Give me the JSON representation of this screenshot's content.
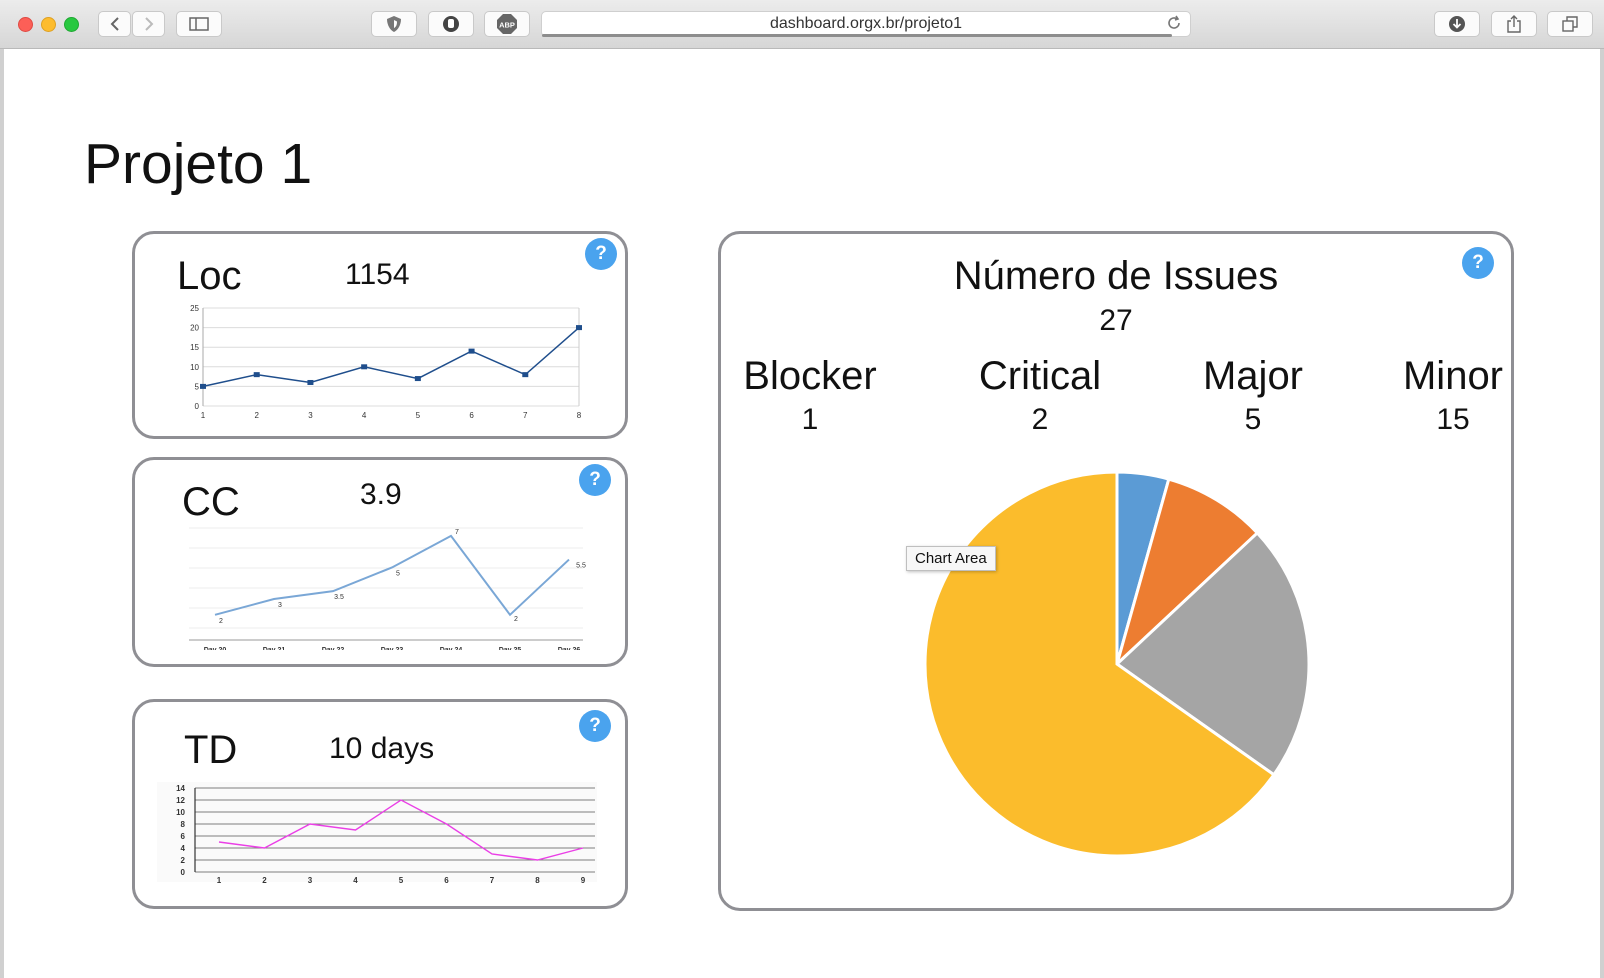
{
  "browser": {
    "url": "dashboard.orgx.br/projeto1",
    "icons": [
      "back-icon",
      "forward-icon",
      "sidebar-icon",
      "shield-icon",
      "hand-icon",
      "adblock-icon",
      "reload-icon",
      "download-icon",
      "share-icon",
      "tabs-icon"
    ],
    "adblock_label": "ABP"
  },
  "page": {
    "title": "Projeto 1"
  },
  "help_label": "?",
  "cards": {
    "loc": {
      "label": "Loc",
      "value": "1154",
      "chart_data": {
        "type": "line",
        "x": [
          1,
          2,
          3,
          4,
          5,
          6,
          7,
          8
        ],
        "values": [
          5,
          8,
          6,
          10,
          7,
          14,
          8,
          20
        ],
        "ylim": [
          0,
          25
        ],
        "yticks": [
          0,
          5,
          10,
          15,
          20,
          25
        ],
        "color": "#1f4e8c"
      }
    },
    "cc": {
      "label": "CC",
      "value": "3.9",
      "chart_data": {
        "type": "line",
        "categories": [
          "Day 20",
          "Day 21",
          "Day 22",
          "Day 23",
          "Day 24",
          "Day 25",
          "Day 26"
        ],
        "values": [
          2,
          3,
          3.5,
          5,
          7,
          2,
          5.5
        ],
        "data_labels": [
          "2",
          "3",
          "3.5",
          "5",
          "7",
          "2",
          "5.5"
        ],
        "ylim": [
          1,
          7.5
        ],
        "color": "#7aa7d6"
      }
    },
    "td": {
      "label": "TD",
      "value": "10 days",
      "chart_data": {
        "type": "line",
        "x": [
          1,
          2,
          3,
          4,
          5,
          6,
          7,
          8,
          9
        ],
        "values": [
          5,
          4,
          8,
          7,
          12,
          8,
          3,
          2,
          4
        ],
        "ylim": [
          0,
          14
        ],
        "yticks": [
          0,
          2,
          4,
          6,
          8,
          10,
          12,
          14
        ],
        "color": "#ea3fe6"
      }
    }
  },
  "issues": {
    "title": "Número de Issues",
    "total": "27",
    "tooltip": "Chart Area",
    "categories": [
      {
        "name": "Blocker",
        "value": "1"
      },
      {
        "name": "Critical",
        "value": "2"
      },
      {
        "name": "Major",
        "value": "5"
      },
      {
        "name": "Minor",
        "value": "15"
      }
    ],
    "chart_data": {
      "type": "pie",
      "labels": [
        "Blocker",
        "Critical",
        "Major",
        "Minor"
      ],
      "values": [
        1,
        2,
        5,
        15
      ],
      "colors": [
        "#5b9bd5",
        "#ed7d31",
        "#a5a5a5",
        "#fbbc2c"
      ]
    }
  }
}
